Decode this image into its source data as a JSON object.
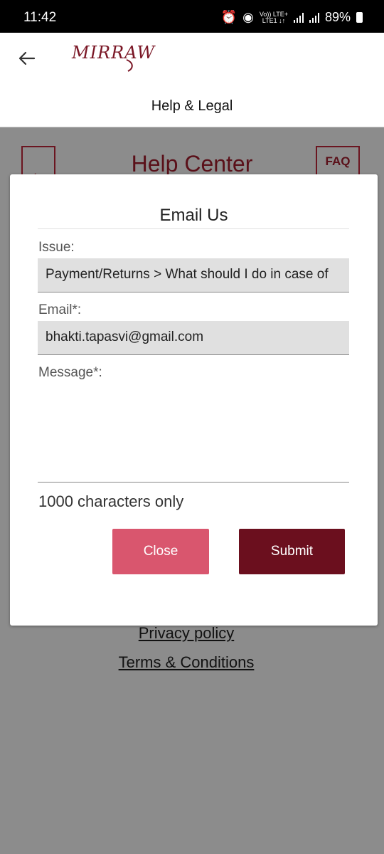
{
  "status_bar": {
    "time": "11:42",
    "network_top": "Vo)) LTE+",
    "network_bottom": "LTE1 ↓↑",
    "battery": "89%"
  },
  "header": {
    "brand": "MIRRAW",
    "title": "Help & Legal",
    "back_icon": "back-arrow-icon"
  },
  "background_page": {
    "title": "Help Center",
    "faq_label": "FAQ",
    "links": [
      "Privacy policy",
      "Terms & Conditions"
    ]
  },
  "modal": {
    "title": "Email Us",
    "issue_label": "Issue:",
    "issue_value": "Payment/Returns > What should I do in case of",
    "email_label": "Email*:",
    "email_value": "bhakti.tapasvi@gmail.com",
    "message_label": "Message*:",
    "message_value": "",
    "char_note": "1000 characters only",
    "close_label": "Close",
    "submit_label": "Submit"
  },
  "colors": {
    "brand": "#7a1625",
    "close_button": "#d9566e",
    "submit_button": "#6b0f1e",
    "overlay": "#8c8c8c"
  }
}
